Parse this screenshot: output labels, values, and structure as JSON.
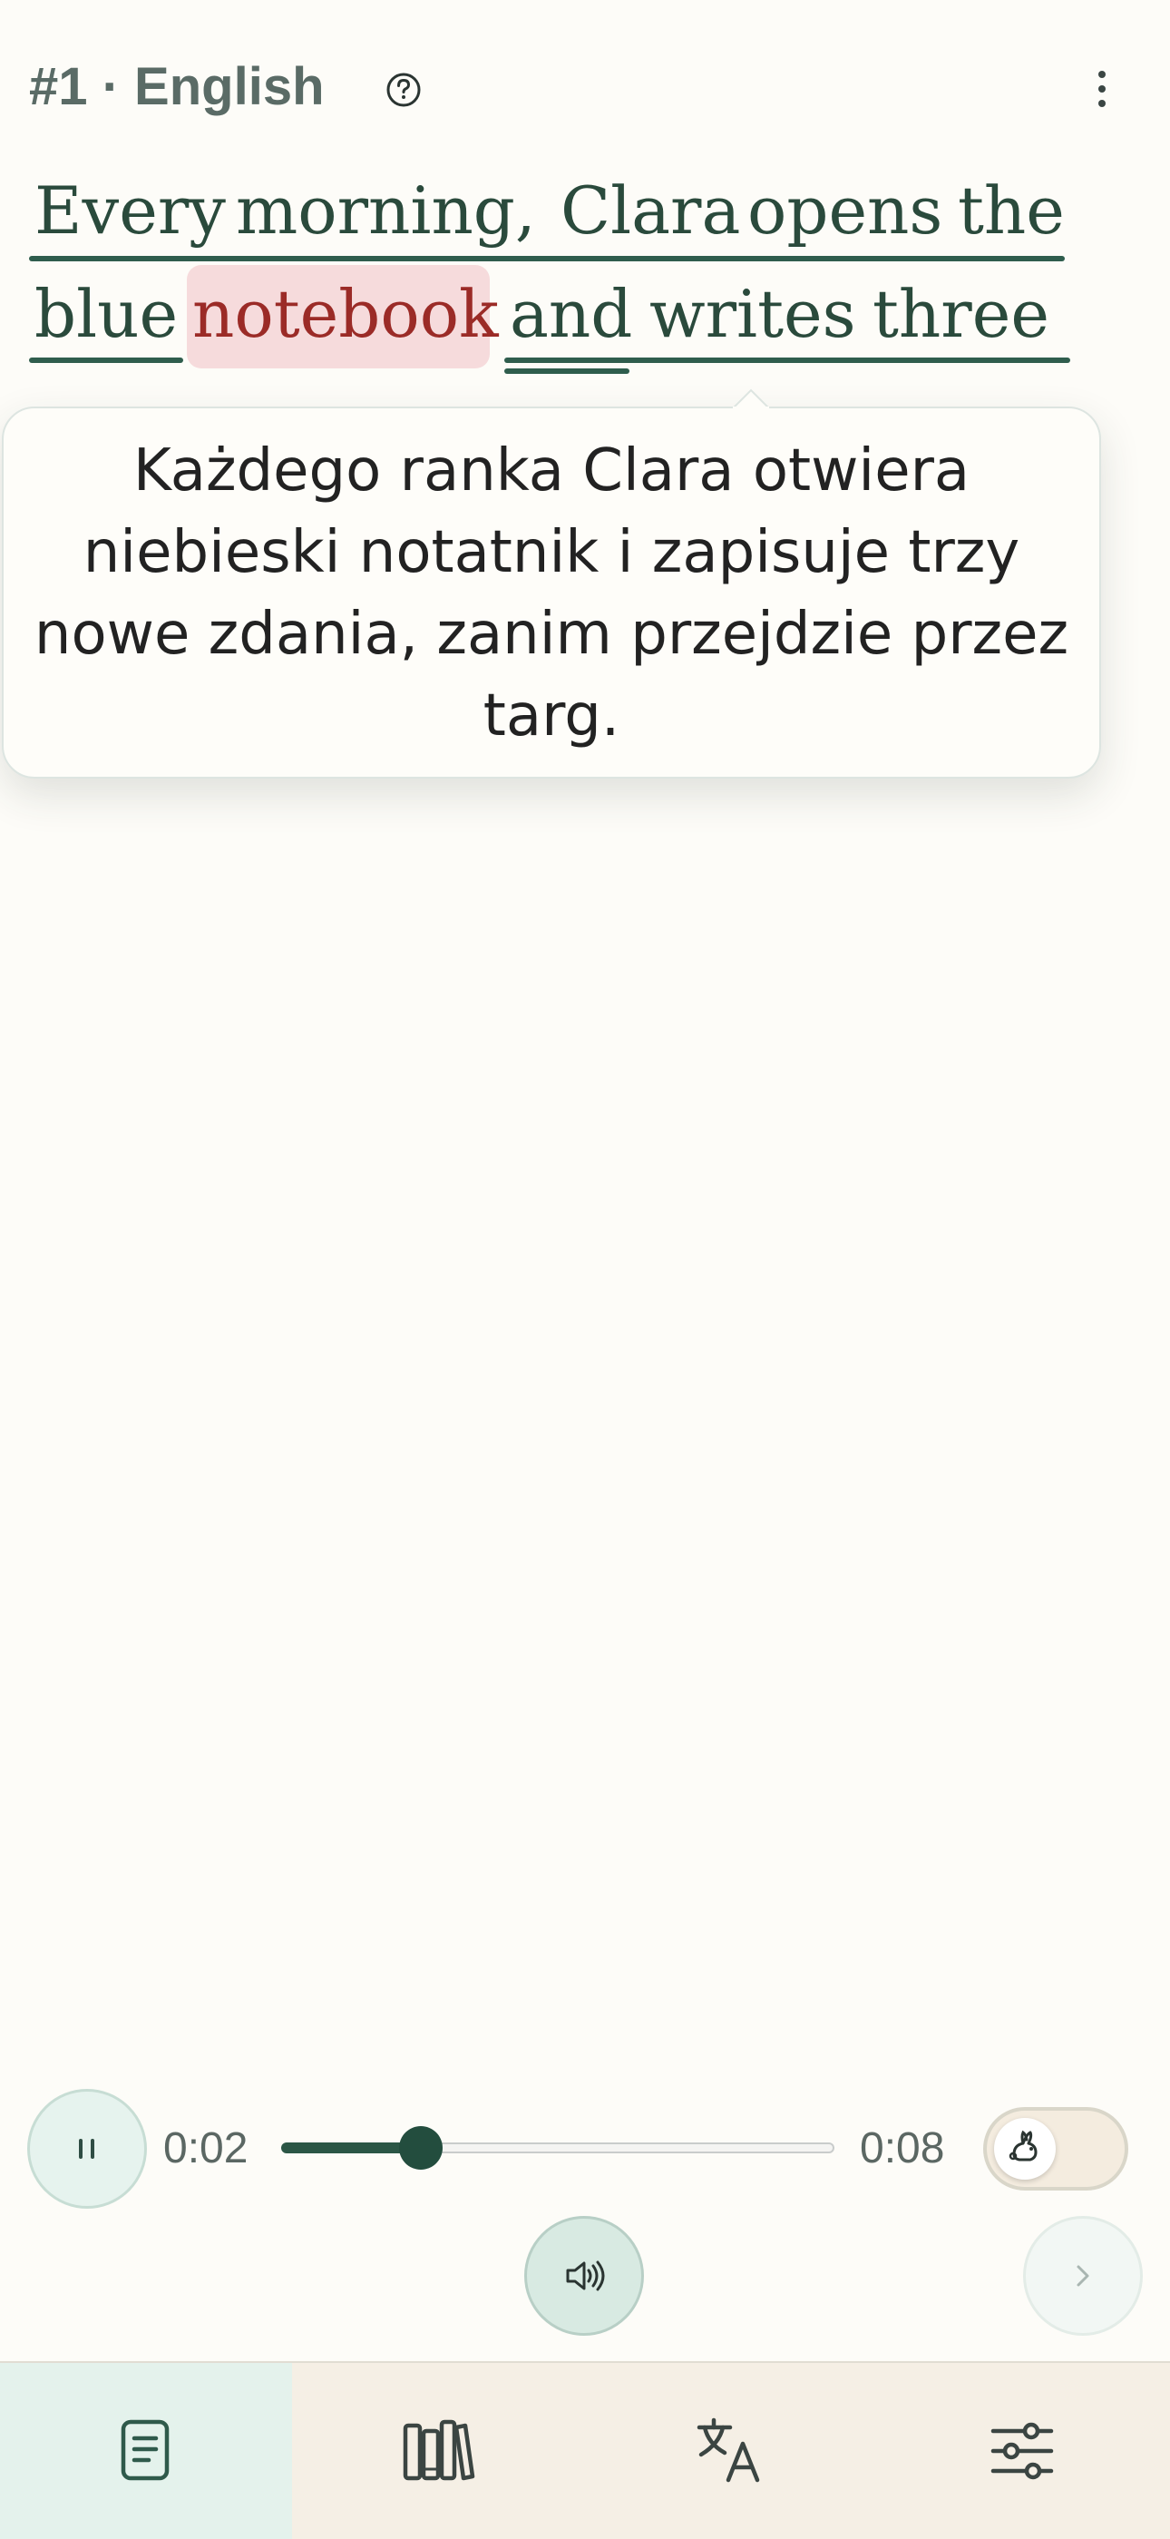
{
  "header": {
    "lesson_title": "#1 · English",
    "help_icon": "question-circle-icon",
    "menu_icon": "vertical-ellipsis-icon"
  },
  "sentence": {
    "line1": [
      "Every",
      "morning,",
      "Clara",
      "opens",
      "the"
    ],
    "line2": [
      "blue",
      "notebook",
      "and",
      "writes",
      "three"
    ],
    "highlighted_word": "notebook"
  },
  "translation": {
    "text": "Każdego ranka Clara otwiera niebieski notatnik i zapisuje trzy nowe zdania, zanim przejdzie przez targ."
  },
  "player": {
    "elapsed": "0:02",
    "duration": "0:08",
    "progress_fraction": 0.25,
    "pause_icon": "pause-icon",
    "speaker_icon": "speaker-icon",
    "next_icon": "chevron-right-icon",
    "slow_mode_icon": "rabbit-icon",
    "slow_mode_on": false
  },
  "nav": {
    "items": [
      {
        "name": "reader",
        "icon": "document-icon",
        "active": true
      },
      {
        "name": "library",
        "icon": "books-icon",
        "active": false
      },
      {
        "name": "translate",
        "icon": "translate-icon",
        "active": false
      },
      {
        "name": "settings",
        "icon": "sliders-icon",
        "active": false
      }
    ]
  },
  "colors": {
    "background": "#fdfcf8",
    "accent": "#2b5646",
    "highlight": "#f6dbdc",
    "nav_active": "#e4f2ec",
    "nav_bg": "#f5efe5"
  }
}
